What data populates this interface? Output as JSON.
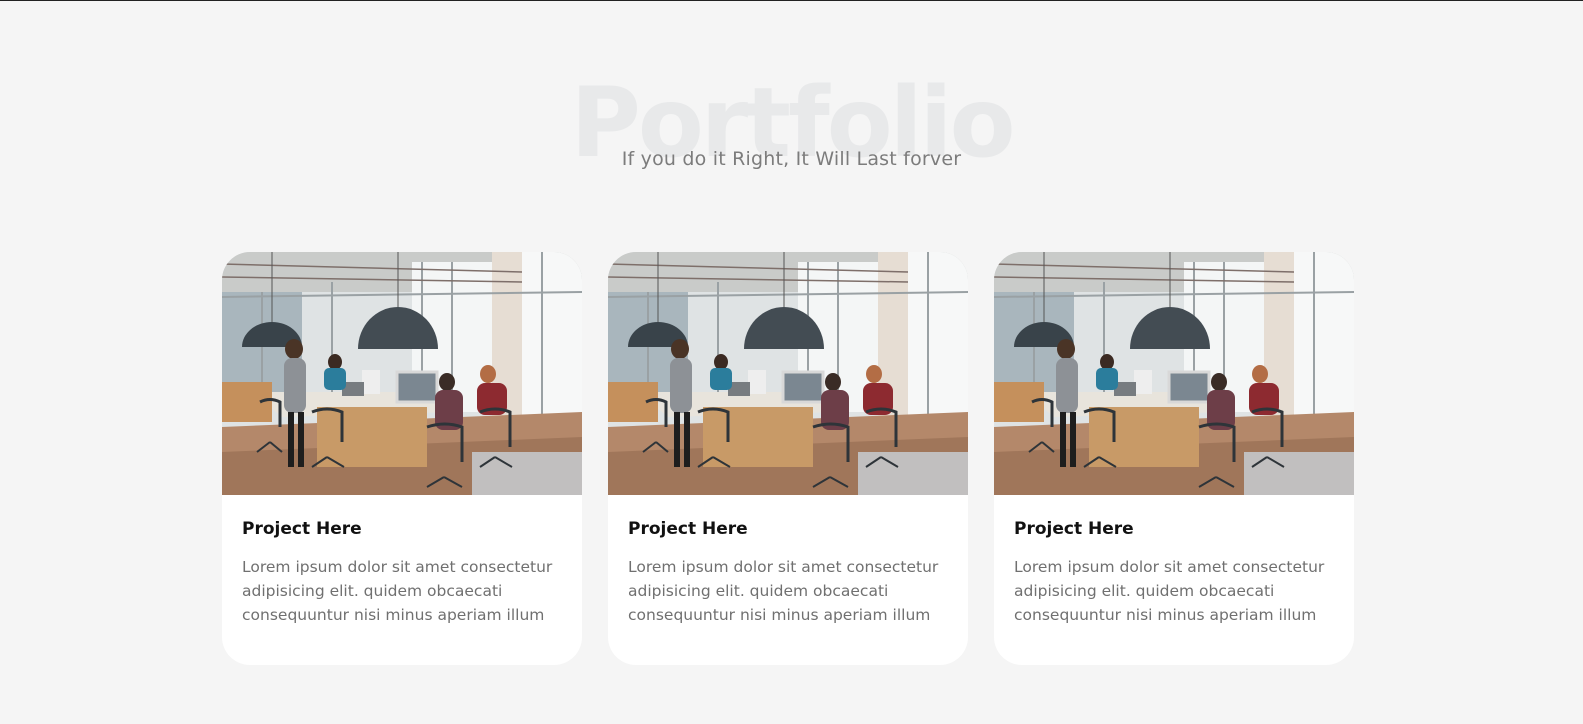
{
  "section": {
    "title": "Portfolio",
    "subtitle": "If you do it Right, It Will Last forver"
  },
  "cards": [
    {
      "image": "office-team-photo",
      "title": "Project Here",
      "text": "Lorem ipsum dolor sit amet consectetur adipisicing elit. quidem obcaecati consequuntur nisi minus aperiam illum"
    },
    {
      "image": "office-team-photo",
      "title": "Project Here",
      "text": "Lorem ipsum dolor sit amet consectetur adipisicing elit. quidem obcaecati consequuntur nisi minus aperiam illum"
    },
    {
      "image": "office-team-photo",
      "title": "Project Here",
      "text": "Lorem ipsum dolor sit amet consectetur adipisicing elit. quidem obcaecati consequuntur nisi minus aperiam illum"
    }
  ],
  "colors": {
    "background": "#f5f5f5",
    "card": "#ffffff",
    "title_watermark": "#e8e9ea",
    "subtitle": "#7c7c7c",
    "card_title": "#111111",
    "card_text": "#707070"
  }
}
